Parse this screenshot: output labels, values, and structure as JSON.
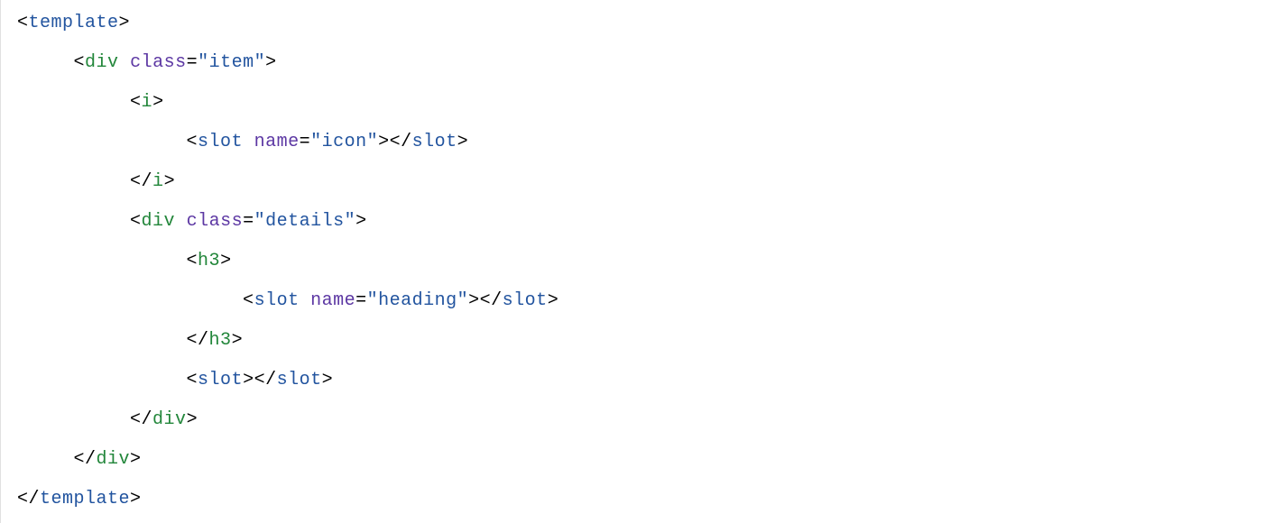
{
  "code": {
    "tags": {
      "template": "template",
      "div": "div",
      "i": "i",
      "slot": "slot",
      "h3": "h3"
    },
    "attrs": {
      "class": "class",
      "name": "name"
    },
    "values": {
      "item": "\"item\"",
      "icon": "\"icon\"",
      "details": "\"details\"",
      "heading": "\"heading\""
    },
    "indent": {
      "l0": "",
      "l1": "     ",
      "l2": "          ",
      "l3": "               ",
      "l4": "                    "
    }
  }
}
